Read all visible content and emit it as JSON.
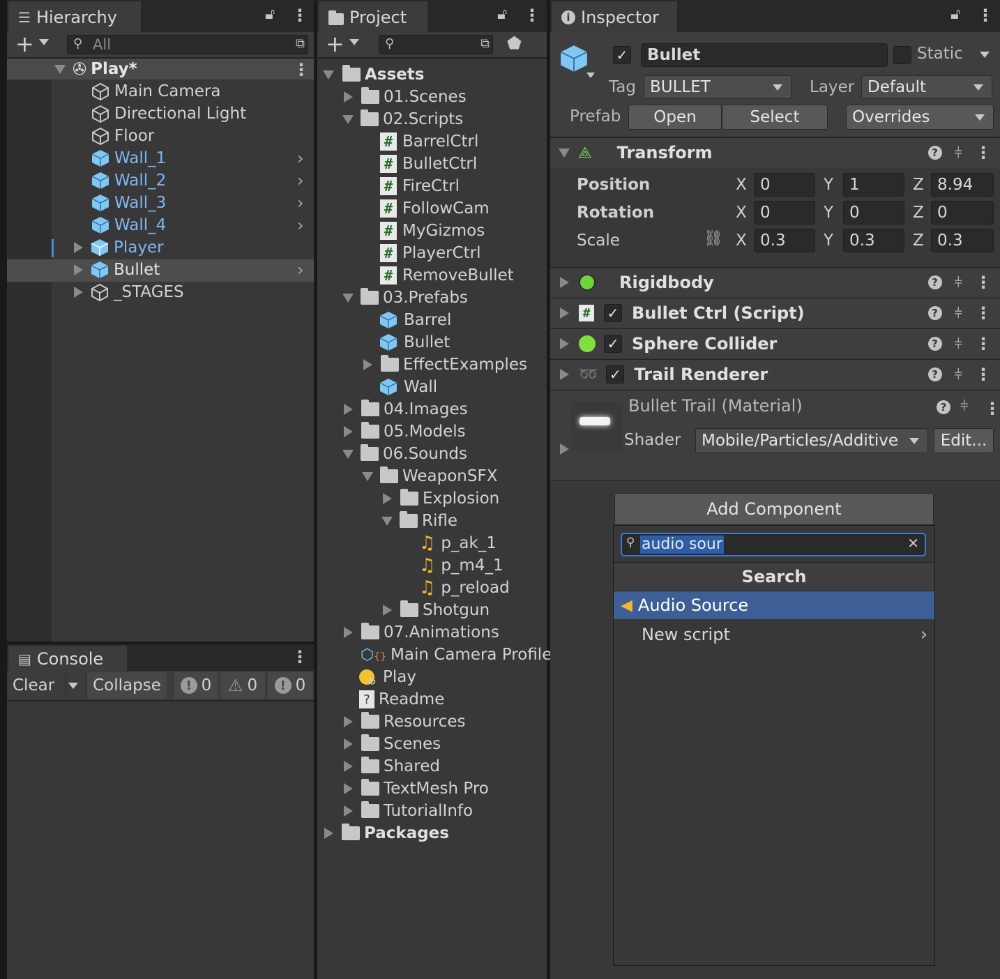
{
  "hierarchy": {
    "tab_label": "Hierarchy",
    "search_placeholder": "All",
    "scene_name": "Play*",
    "items": [
      {
        "label": "Main Camera"
      },
      {
        "label": "Directional Light"
      },
      {
        "label": "Floor"
      },
      {
        "label": "Wall_1"
      },
      {
        "label": "Wall_2"
      },
      {
        "label": "Wall_3"
      },
      {
        "label": "Wall_4"
      },
      {
        "label": "Player"
      },
      {
        "label": "Bullet"
      },
      {
        "label": "_STAGES"
      }
    ]
  },
  "console": {
    "tab_label": "Console",
    "clear_label": "Clear",
    "collapse_label": "Collapse",
    "info_count": "0",
    "warning_count": "0",
    "error_count": "0"
  },
  "project": {
    "tab_label": "Project",
    "items": [
      {
        "label": "Assets"
      },
      {
        "label": "01.Scenes"
      },
      {
        "label": "02.Scripts"
      },
      {
        "label": "BarrelCtrl"
      },
      {
        "label": "BulletCtrl"
      },
      {
        "label": "FireCtrl"
      },
      {
        "label": "FollowCam"
      },
      {
        "label": "MyGizmos"
      },
      {
        "label": "PlayerCtrl"
      },
      {
        "label": "RemoveBullet"
      },
      {
        "label": "03.Prefabs"
      },
      {
        "label": "Barrel"
      },
      {
        "label": "Bullet"
      },
      {
        "label": "EffectExamples"
      },
      {
        "label": "Wall"
      },
      {
        "label": "04.Images"
      },
      {
        "label": "05.Models"
      },
      {
        "label": "06.Sounds"
      },
      {
        "label": "WeaponSFX"
      },
      {
        "label": "Explosion"
      },
      {
        "label": "Rifle"
      },
      {
        "label": "p_ak_1"
      },
      {
        "label": "p_m4_1"
      },
      {
        "label": "p_reload"
      },
      {
        "label": "Shotgun"
      },
      {
        "label": "07.Animations"
      },
      {
        "label": "Main Camera Profile"
      },
      {
        "label": "Play"
      },
      {
        "label": "Readme"
      },
      {
        "label": "Resources"
      },
      {
        "label": "Scenes"
      },
      {
        "label": "Shared"
      },
      {
        "label": "TextMesh Pro"
      },
      {
        "label": "TutorialInfo"
      },
      {
        "label": "Packages"
      }
    ]
  },
  "inspector": {
    "tab_label": "Inspector",
    "object_name": "Bullet",
    "static_label": "Static",
    "tag_label": "Tag",
    "tag_value": "BULLET",
    "layer_label": "Layer",
    "layer_value": "Default",
    "prefab_label": "Prefab",
    "open_label": "Open",
    "select_label": "Select",
    "overrides_label": "Overrides",
    "transform": {
      "title": "Transform",
      "position_label": "Position",
      "rotation_label": "Rotation",
      "scale_label": "Scale",
      "x": "X",
      "y": "Y",
      "z": "Z",
      "position": [
        "0",
        "1",
        "8.94"
      ],
      "rotation": [
        "0",
        "0",
        "0"
      ],
      "scale": [
        "0.3",
        "0.3",
        "0.3"
      ]
    },
    "components": [
      {
        "title": "Rigidbody"
      },
      {
        "title": "Bullet Ctrl (Script)"
      },
      {
        "title": "Sphere Collider"
      },
      {
        "title": "Trail Renderer"
      }
    ],
    "material": {
      "title": "Bullet Trail (Material)",
      "shader_label": "Shader",
      "shader_value": "Mobile/Particles/Additive",
      "edit_label": "Edit..."
    },
    "add_component": {
      "button_label": "Add Component",
      "search_value": "audio sour",
      "section_title": "Search",
      "results": [
        {
          "label": "Audio Source"
        },
        {
          "label": "New script"
        }
      ]
    }
  },
  "colors": {
    "selection_blue": "#3e5f96",
    "prefab_blue": "#7fb6f2",
    "panel_bg": "#383838"
  }
}
